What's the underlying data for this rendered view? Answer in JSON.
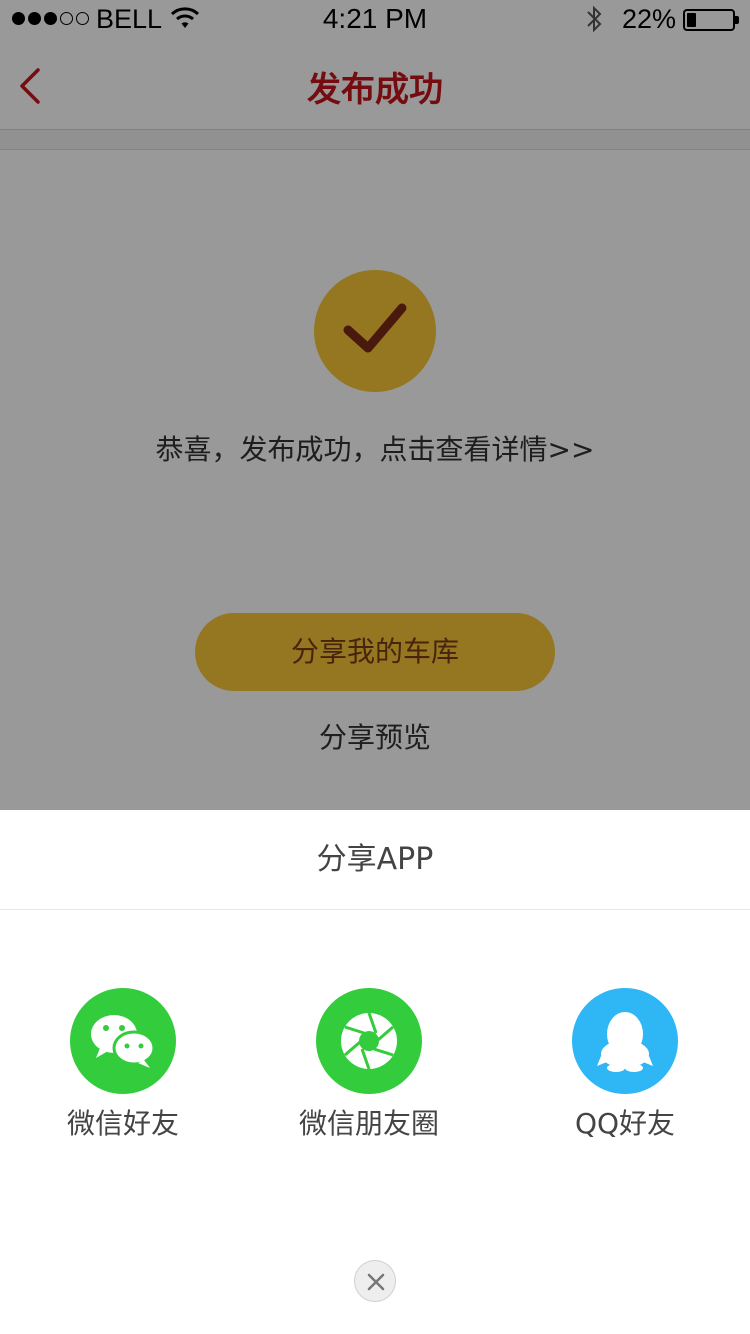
{
  "status_bar": {
    "carrier": "BELL",
    "time": "4:21 PM",
    "battery_percent": "22%",
    "signal_bars_filled": 3,
    "signal_bars_total": 5
  },
  "navbar": {
    "title": "发布成功",
    "back_icon": "chevron-left-icon"
  },
  "main": {
    "success_icon": "checkmark-icon",
    "success_message": "恭喜，发布成功，点击查看详情>>",
    "share_garage_label": "分享我的车库",
    "share_preview_label": "分享预览"
  },
  "share_sheet": {
    "title": "分享APP",
    "options": [
      {
        "label": "微信好友",
        "icon": "wechat-icon",
        "color": "#33cc3c"
      },
      {
        "label": "微信朋友圈",
        "icon": "wechat-moments-icon",
        "color": "#33cc3c"
      },
      {
        "label": "QQ好友",
        "icon": "qq-icon",
        "color": "#2fb6f5"
      }
    ],
    "close_icon": "close-icon"
  },
  "colors": {
    "accent_red": "#c4161c",
    "accent_yellow": "#f7c736",
    "overlay": "rgba(0,0,0,0.40)"
  }
}
